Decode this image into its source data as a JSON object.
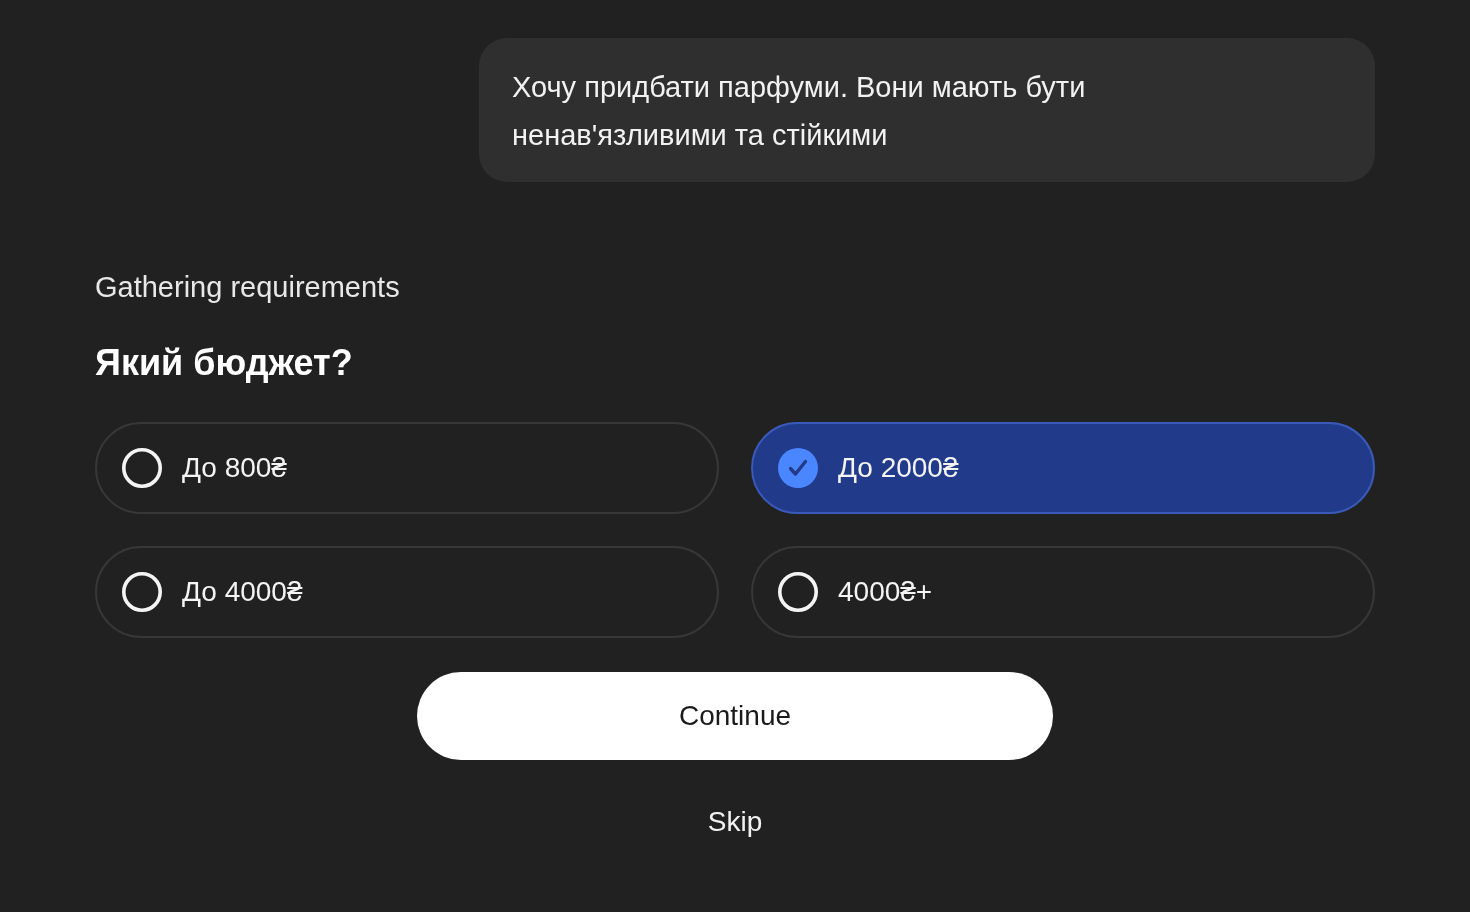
{
  "message": {
    "text": "Хочу придбати парфуми. Вони мають бути ненав'язливими та стійкими"
  },
  "status": "Gathering requirements",
  "question": "Який бюджет?",
  "options": [
    {
      "label": "До 800₴",
      "selected": false
    },
    {
      "label": "До 2000₴",
      "selected": true
    },
    {
      "label": "До 4000₴",
      "selected": false
    },
    {
      "label": "4000₴+",
      "selected": false
    }
  ],
  "buttons": [
    {
      "label": "Continue",
      "kind": "primary"
    },
    {
      "label": "Skip",
      "kind": "text"
    }
  ]
}
